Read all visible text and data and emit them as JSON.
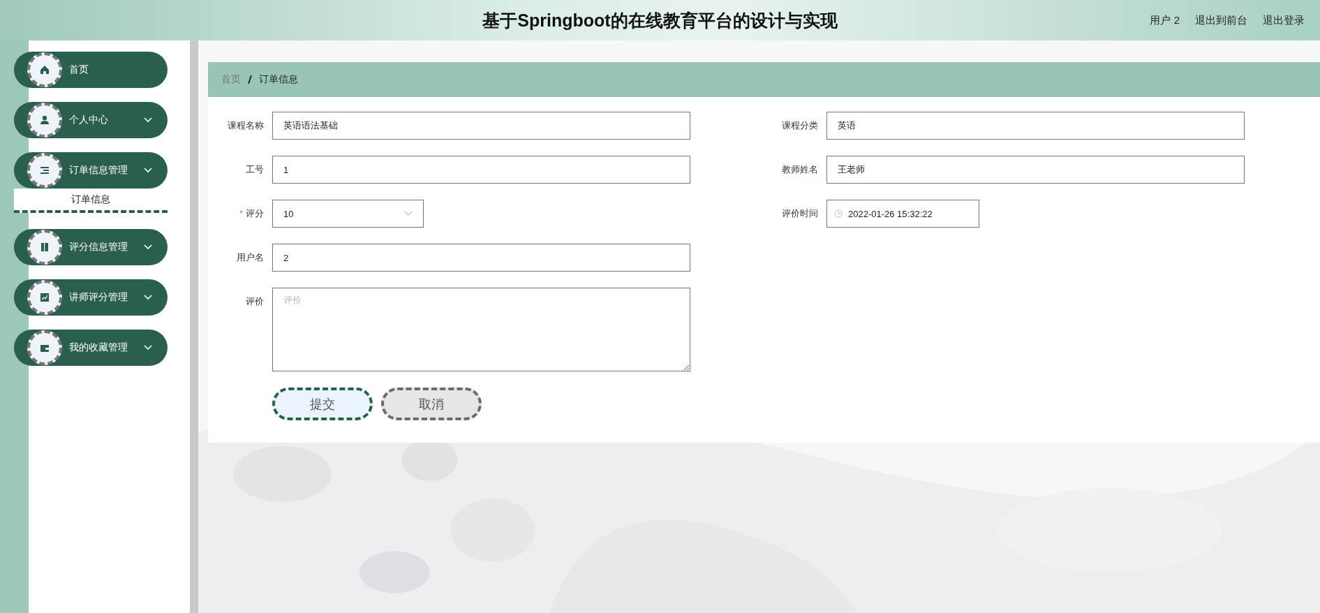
{
  "header": {
    "title": "基于Springboot的在线教育平台的设计与实现",
    "links": [
      "用户 2",
      "退出到前台",
      "退出登录"
    ]
  },
  "sidebar": {
    "items": [
      {
        "label": "首页",
        "expandable": false
      },
      {
        "label": "个人中心",
        "expandable": true
      },
      {
        "label": "订单信息管理",
        "expandable": true,
        "children": [
          {
            "label": "订单信息",
            "selected": true
          }
        ]
      },
      {
        "label": "评分信息管理",
        "expandable": true
      },
      {
        "label": "讲师评分管理",
        "expandable": true
      },
      {
        "label": "我的收藏管理",
        "expandable": true
      }
    ]
  },
  "breadcrumb": [
    {
      "label": "首页",
      "current": false
    },
    {
      "label": "订单信息",
      "current": true
    }
  ],
  "form": {
    "rows": [
      {
        "fields": [
          {
            "kind": "text",
            "label": "课程名称",
            "value": "英语语法基础"
          },
          {
            "kind": "text",
            "label": "课程分类",
            "value": "英语"
          }
        ]
      },
      {
        "fields": [
          {
            "kind": "text",
            "label": "工号",
            "value": "1"
          },
          {
            "kind": "text",
            "label": "教师姓名",
            "value": "王老师"
          }
        ]
      },
      {
        "fields": [
          {
            "kind": "select",
            "label": "评分",
            "value": "10",
            "required_mark": "*"
          },
          {
            "kind": "datetime",
            "label": "评价时间",
            "value": "2022-01-26 15:32:22"
          }
        ]
      },
      {
        "fields": [
          {
            "kind": "text",
            "label": "用户名",
            "value": "2"
          }
        ]
      },
      {
        "fields": [
          {
            "kind": "textarea",
            "label": "评价",
            "placeholder": "评价"
          }
        ]
      }
    ],
    "buttons": [
      {
        "label": "提交",
        "kind": "primary"
      },
      {
        "label": "取消",
        "kind": "default"
      }
    ]
  }
}
